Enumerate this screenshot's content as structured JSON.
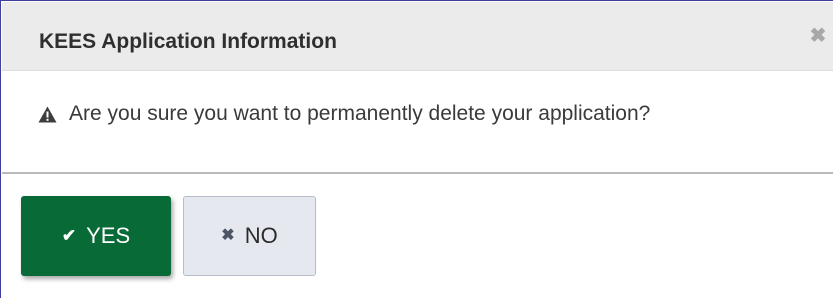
{
  "dialog": {
    "title": "KEES Application Information",
    "close_icon": "✖",
    "message": "Are you sure you want to permanently delete your application?",
    "message_icon": "warning-icon"
  },
  "buttons": {
    "yes": {
      "icon": "✔",
      "label": "YES"
    },
    "no": {
      "icon": "✖",
      "label": "NO"
    }
  },
  "colors": {
    "yes_bg": "#086a36",
    "no_bg": "#e5e9ef",
    "titlebar_bg": "#ebebeb"
  }
}
